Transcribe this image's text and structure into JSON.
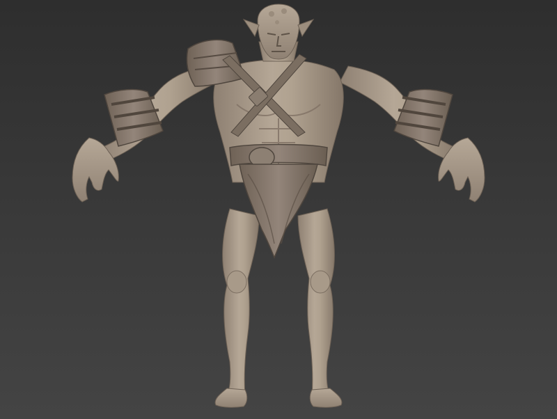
{
  "scene": {
    "subject": "sculpted-character-model",
    "pose": "a-pose",
    "colors": {
      "background_top": "#2e2e2e",
      "background_bottom": "#444444",
      "clay_light": "#b8aa9a",
      "clay_mid": "#a29382",
      "clay_dark": "#7d6f61",
      "clay_shadow": "#5e5348"
    }
  }
}
